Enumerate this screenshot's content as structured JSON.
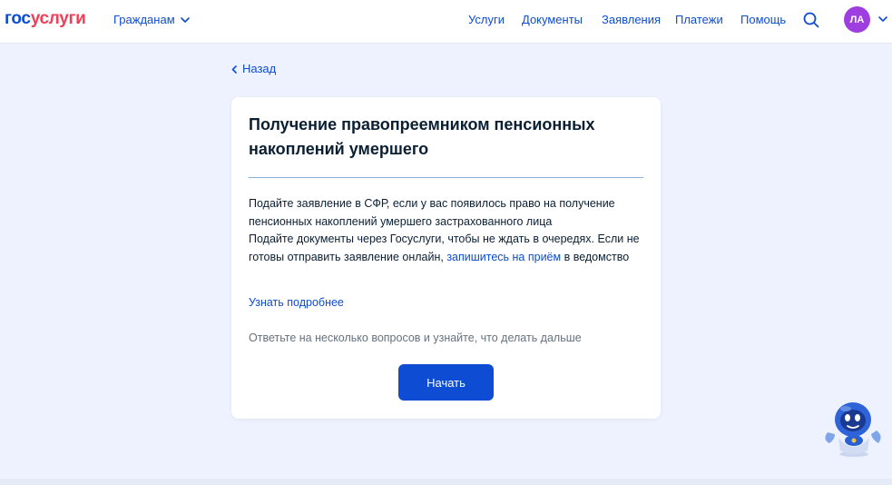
{
  "header": {
    "logo_gos": "гос",
    "logo_usl": "услуги",
    "audience_label": "Гражданам",
    "nav": [
      {
        "label": "Услуги"
      },
      {
        "label": "Документы"
      },
      {
        "label": "Заявления"
      },
      {
        "label": "Платежи"
      },
      {
        "label": "Помощь"
      }
    ],
    "avatar_initials": "ЛА"
  },
  "back_label": "Назад",
  "card": {
    "title": "Получение правопреемником пенсионных накоплений умершего",
    "paragraph1": "Подайте заявление в СФР, если у вас появилось право на получение пенсионных накоплений умершего застрахованного лица",
    "paragraph2_before": "Подайте документы через Госуслуги, чтобы не ждать в очередях. Если не готовы отправить заявление онлайн, ",
    "paragraph2_link": "запишитесь на приём",
    "paragraph2_after": " в ведомство",
    "more_link": "Узнать подробнее",
    "hint": "Ответьте на несколько вопросов и узнайте, что делать дальше",
    "start_button": "Начать"
  },
  "colors": {
    "brand_blue": "#0d4cd3",
    "brand_red": "#ee3f58",
    "page_bg": "#edf2fe",
    "avatar_bg": "#9f3ee0"
  },
  "icons": [
    "chevron-down-icon",
    "search-icon",
    "chevron-left-icon",
    "robot-assistant-icon"
  ]
}
